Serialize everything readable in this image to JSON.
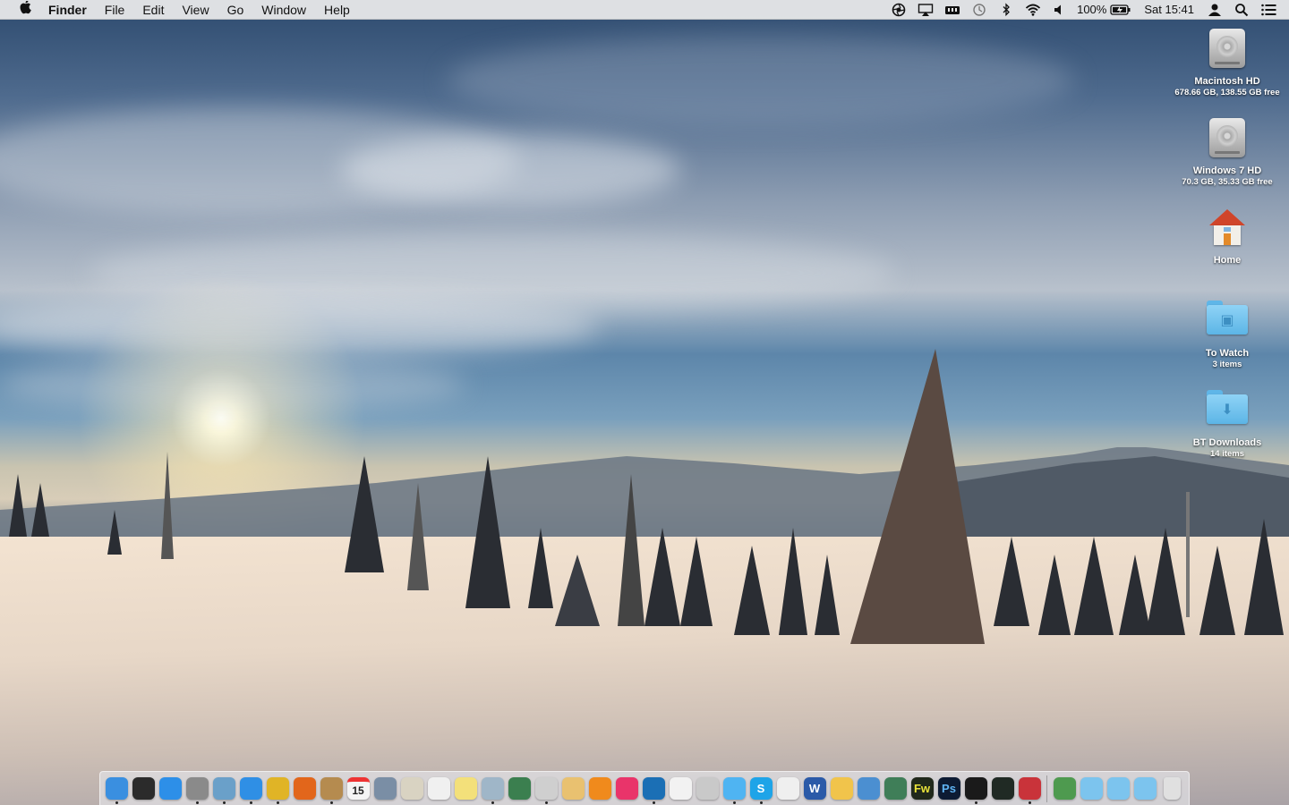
{
  "menubar": {
    "apple_icon": "apple-logo-icon",
    "app_name": "Finder",
    "menus": [
      "File",
      "Edit",
      "View",
      "Go",
      "Window",
      "Help"
    ],
    "status": {
      "battery_percent": "100%",
      "clock": "Sat 15:41"
    }
  },
  "desktop": {
    "icons": [
      {
        "name": "Macintosh HD",
        "info": "678.66 GB, 138.55 GB free",
        "kind": "hard-drive-icon"
      },
      {
        "name": "Windows 7 HD",
        "info": "70.3 GB, 35.33 GB free",
        "kind": "hard-drive-icon"
      },
      {
        "name": "Home",
        "info": "",
        "kind": "home-folder-icon"
      },
      {
        "name": "To Watch",
        "info": "3 items",
        "kind": "folder-icon"
      },
      {
        "name": "BT Downloads",
        "info": "14 items",
        "kind": "folder-icon"
      }
    ]
  },
  "dock": {
    "calendar_day": "15",
    "items": [
      {
        "icon": "finder-icon",
        "color": "#3a8fe0"
      },
      {
        "icon": "dashboard-icon",
        "color": "#2b2b2b"
      },
      {
        "icon": "app-store-icon",
        "color": "#2d8fe8"
      },
      {
        "icon": "system-preferences-icon",
        "color": "#8a8a8a"
      },
      {
        "icon": "preview-icon",
        "color": "#6aa0c9"
      },
      {
        "icon": "safari-icon",
        "color": "#2f8fe5"
      },
      {
        "icon": "chrome-icon",
        "color": "#e0b426"
      },
      {
        "icon": "firefox-icon",
        "color": "#e2661b"
      },
      {
        "icon": "notes-book-icon",
        "color": "#b58b4f"
      },
      {
        "icon": "calendar-icon",
        "color": "#f4f4f4"
      },
      {
        "icon": "image-capture-icon",
        "color": "#7a8ea5"
      },
      {
        "icon": "script-editor-icon",
        "color": "#d9d3c2"
      },
      {
        "icon": "textedit-icon",
        "color": "#f0f0f0"
      },
      {
        "icon": "stickies-icon",
        "color": "#f3e07a"
      },
      {
        "icon": "photo-app-icon",
        "color": "#9fb6c8"
      },
      {
        "icon": "iphoto-icon",
        "color": "#3b7f4f"
      },
      {
        "icon": "time-machine-icon",
        "color": "#cfcfcf"
      },
      {
        "icon": "garageband-icon",
        "color": "#e9c170"
      },
      {
        "icon": "ibooks-icon",
        "color": "#f08a1c"
      },
      {
        "icon": "itunes-icon",
        "color": "#e9346a"
      },
      {
        "icon": "quicktime-icon",
        "color": "#1b6fb5"
      },
      {
        "icon": "vlc-icon",
        "color": "#f2f2f2"
      },
      {
        "icon": "tweetbot-icon",
        "color": "#c9c9c9"
      },
      {
        "icon": "messages-icon",
        "color": "#4fb4f2"
      },
      {
        "icon": "skype-icon",
        "color": "#1ea4e8"
      },
      {
        "icon": "document-icon",
        "color": "#efefef"
      },
      {
        "icon": "word-icon",
        "color": "#2b5aa8"
      },
      {
        "icon": "pages-icon",
        "color": "#f1c44b"
      },
      {
        "icon": "keynote-icon",
        "color": "#4b8fd1"
      },
      {
        "icon": "dreamweaver-icon",
        "color": "#3f7e58"
      },
      {
        "icon": "fireworks-icon",
        "color": "#20281b"
      },
      {
        "icon": "photoshop-icon",
        "color": "#0d1b33"
      },
      {
        "icon": "terminal-icon",
        "color": "#1a1a1a"
      },
      {
        "icon": "activity-monitor-icon",
        "color": "#202a24"
      },
      {
        "icon": "parallels-icon",
        "color": "#c9333a"
      }
    ],
    "labels": {
      "fireworks": "Fw",
      "photoshop": "Ps",
      "word": "W",
      "skype": "S"
    },
    "right_items": [
      {
        "icon": "desktop-stack-icon",
        "color": "#4e9a4f"
      },
      {
        "icon": "applications-folder-icon",
        "color": "#7cc4ee"
      },
      {
        "icon": "documents-folder-icon",
        "color": "#7cc4ee"
      },
      {
        "icon": "downloads-folder-icon",
        "color": "#7cc4ee"
      },
      {
        "icon": "trash-icon",
        "color": "#e0e0e0"
      }
    ]
  }
}
